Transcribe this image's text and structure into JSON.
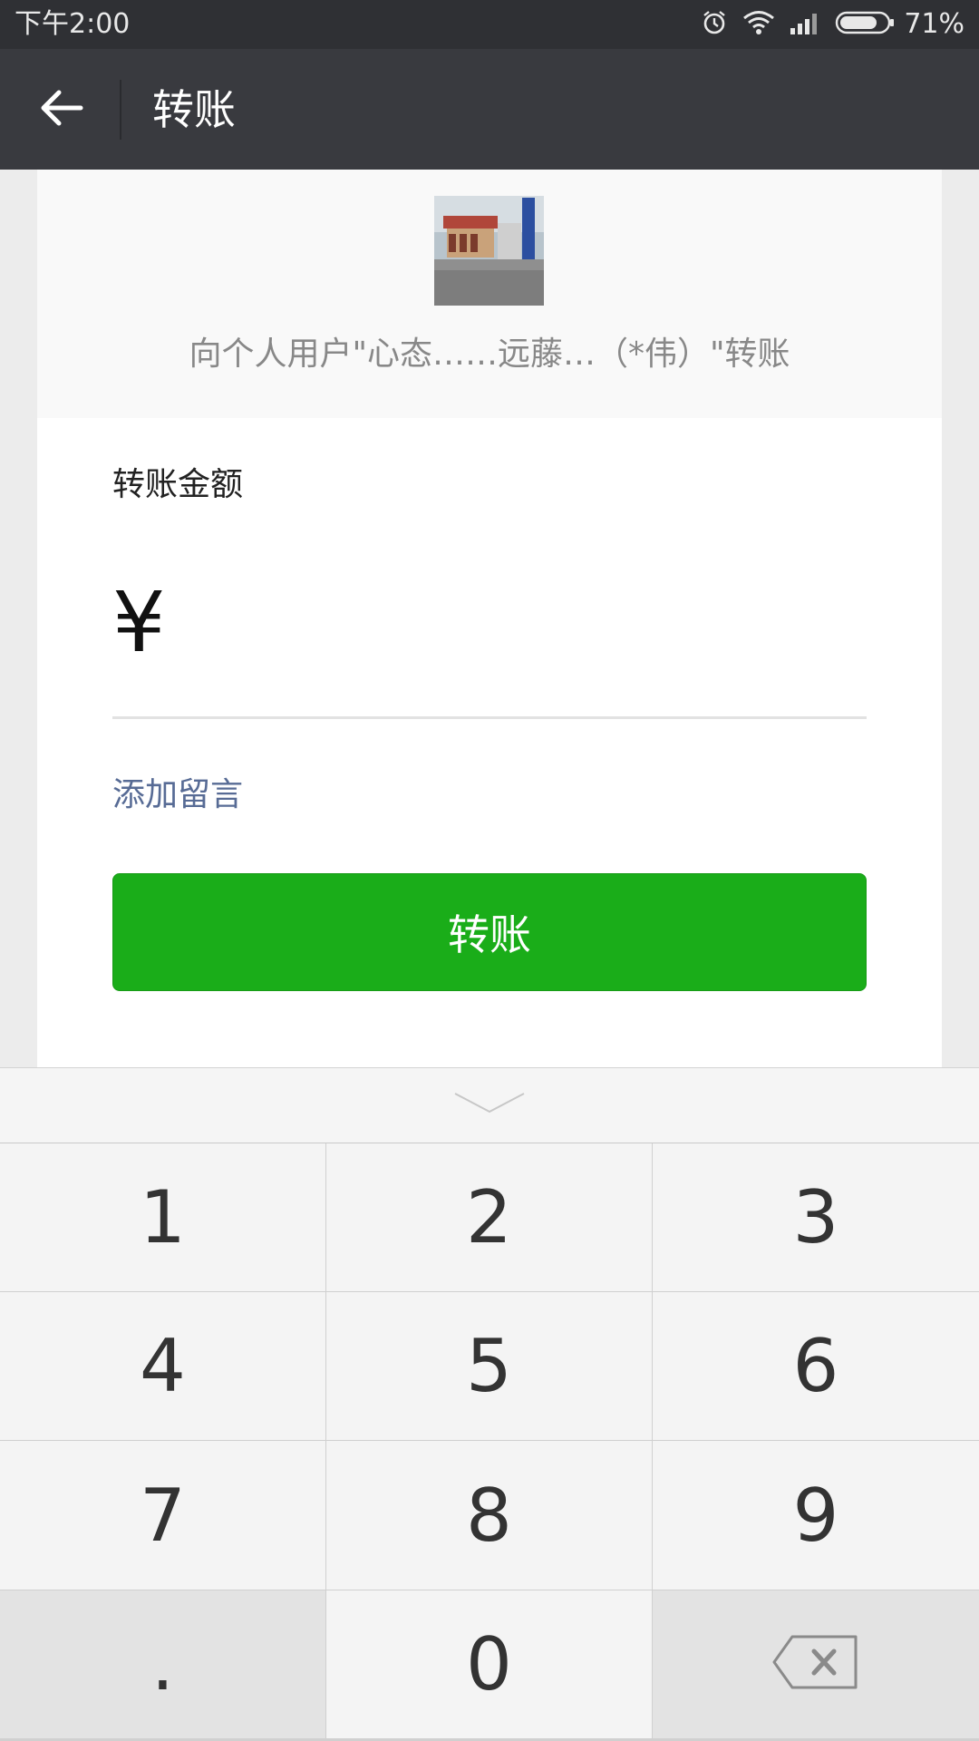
{
  "status_bar": {
    "time": "下午2:00",
    "battery_percent": "71%",
    "icons": [
      "alarm-icon",
      "wifi-icon",
      "signal-icon",
      "battery-icon"
    ]
  },
  "title_bar": {
    "back_icon": "arrow-left-icon",
    "title": "转账"
  },
  "payee": {
    "avatar": "user-avatar-photo",
    "text": "向个人用户\"心态……远藤…（*伟）\"转账"
  },
  "form": {
    "amount_label": "转账金额",
    "currency_symbol": "¥",
    "amount_value": "",
    "add_note": "添加留言",
    "transfer_button": "转账"
  },
  "keyboard": {
    "collapse_icon": "chevron-down-icon",
    "keys": [
      {
        "label": "1",
        "name": "key-1"
      },
      {
        "label": "2",
        "name": "key-2"
      },
      {
        "label": "3",
        "name": "key-3"
      },
      {
        "label": "4",
        "name": "key-4"
      },
      {
        "label": "5",
        "name": "key-5"
      },
      {
        "label": "6",
        "name": "key-6"
      },
      {
        "label": "7",
        "name": "key-7"
      },
      {
        "label": "8",
        "name": "key-8"
      },
      {
        "label": "9",
        "name": "key-9"
      },
      {
        "label": ".",
        "name": "key-decimal"
      },
      {
        "label": "0",
        "name": "key-0"
      },
      {
        "label": "",
        "name": "key-backspace",
        "icon": "backspace-icon"
      }
    ]
  },
  "colors": {
    "status_bar_bg": "#2f3034",
    "title_bar_bg": "#393a3f",
    "primary_green": "#1aad19",
    "link_blue": "#576b95",
    "page_bg": "#ececec"
  }
}
